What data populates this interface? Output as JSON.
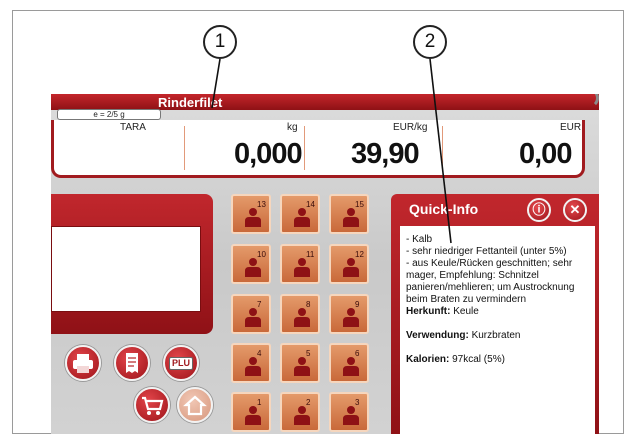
{
  "callouts": [
    "1",
    "2"
  ],
  "window": {
    "title": "Rinderfilet",
    "e_value": "e = 2/5 g"
  },
  "display": {
    "tara_label": "TARA",
    "weight_unit": "kg",
    "weight_value": "0,000",
    "price_unit": "EUR/kg",
    "price_value": "39,90",
    "total_unit": "EUR",
    "total_value": "0,00"
  },
  "keypad": {
    "keys": [
      "13",
      "14",
      "15",
      "10",
      "11",
      "12",
      "7",
      "8",
      "9",
      "4",
      "5",
      "6",
      "1",
      "2",
      "3"
    ]
  },
  "action_buttons": {
    "plu_label": "PLU"
  },
  "quick_info": {
    "title": "Quick-Info",
    "info_icon": "info-icon",
    "close_icon": "close-icon",
    "lines": [
      "- Kalb",
      "- sehr niedriger Fettanteil (unter 5%)",
      "- aus Keule/Rücken geschnitten; sehr mager, Empfehlung: Schnitzel panieren/mehlieren; um Austrocknung beim Braten zu vermindern"
    ],
    "herkunft_label": "Herkunft:",
    "herkunft_value": "Keule",
    "verwendung_label": "Verwendung:",
    "verwendung_value": "Kurzbraten",
    "kalorien_label": "Kalorien:",
    "kalorien_value": "97kcal (5%)"
  },
  "colors": {
    "accent_red": "#a11b1f",
    "key_orange": "#d57b48",
    "person_dark_red": "#8e1115"
  }
}
